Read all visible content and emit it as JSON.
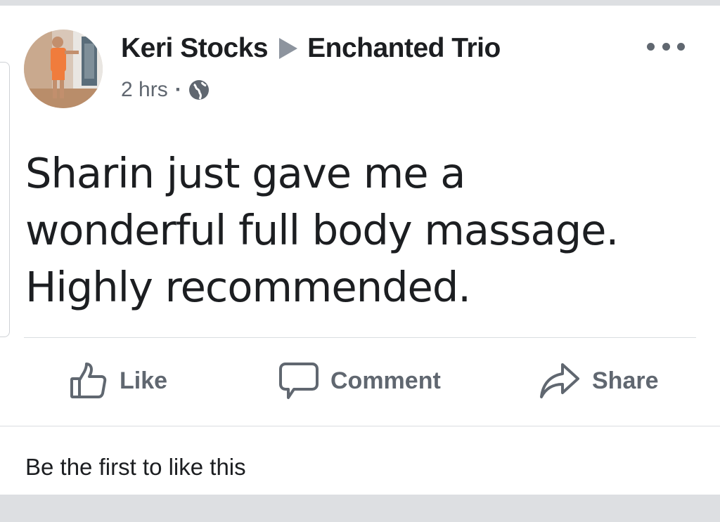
{
  "post": {
    "author": "Keri Stocks",
    "target_group": "Enchanted Trio",
    "time": "2 hrs",
    "separator": "·",
    "text_lines": [
      "Sharin just gave me a",
      "wonderful full body massage.",
      "Highly recommended."
    ]
  },
  "actions": {
    "like_label": "Like",
    "comment_label": "Comment",
    "share_label": "Share"
  },
  "footer": {
    "likes_summary": "Be the first to like this"
  },
  "icons": {
    "arrow": "triangle-right-icon",
    "privacy": "globe-icon",
    "more": "more-dots-icon",
    "like": "thumbs-up-icon",
    "comment": "speech-bubble-icon",
    "share": "share-arrow-icon"
  },
  "colors": {
    "text_primary": "#1c1e21",
    "text_secondary": "#606770",
    "divider": "#dadde1",
    "page_background": "#dddfe2"
  }
}
